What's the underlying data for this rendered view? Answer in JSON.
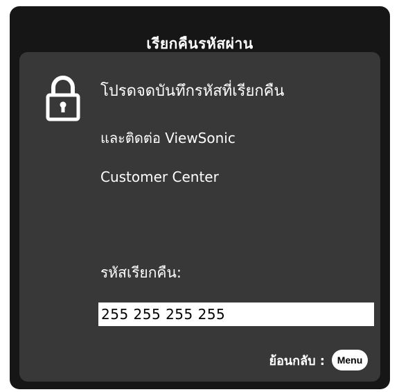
{
  "dialog": {
    "title": "เรียกคืนรหัสผ่าน",
    "lock_icon": "lock-icon",
    "message_line1": "โปรดจดบันทึกรหัสที่เรียกคืน",
    "message_line2": "และติดต่อ ViewSonic",
    "message_line3": "Customer Center",
    "recall_code_label": "รหัสเรียกคืน:",
    "recall_code_value": "255 255 255 255",
    "back_label": "ย้อนกลับ :",
    "menu_button_label": "Menu"
  },
  "colors": {
    "outer_frame": "#161616",
    "panel": "#383838",
    "text": "#ffffff",
    "code_box": "#ffffff"
  }
}
